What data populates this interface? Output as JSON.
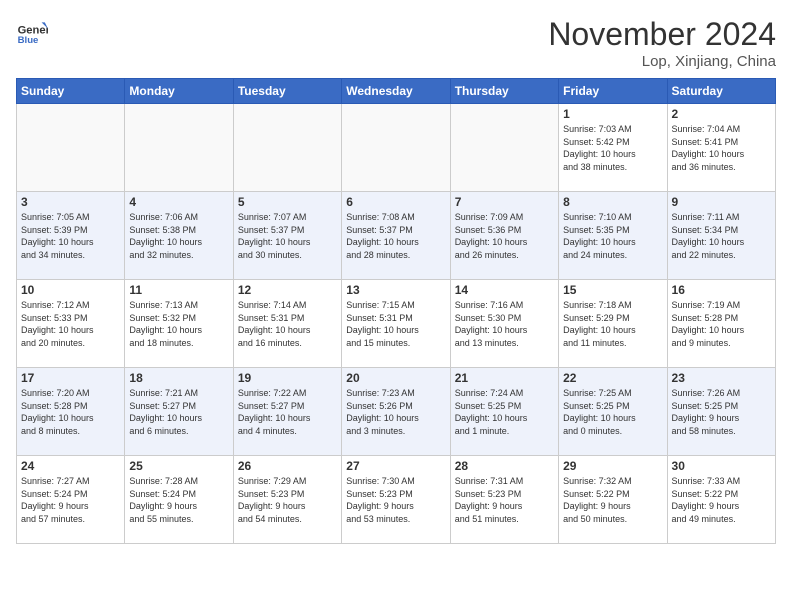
{
  "header": {
    "logo_line1": "General",
    "logo_line2": "Blue",
    "month": "November 2024",
    "location": "Lop, Xinjiang, China"
  },
  "weekdays": [
    "Sunday",
    "Monday",
    "Tuesday",
    "Wednesday",
    "Thursday",
    "Friday",
    "Saturday"
  ],
  "weeks": [
    [
      {
        "day": "",
        "info": ""
      },
      {
        "day": "",
        "info": ""
      },
      {
        "day": "",
        "info": ""
      },
      {
        "day": "",
        "info": ""
      },
      {
        "day": "",
        "info": ""
      },
      {
        "day": "1",
        "info": "Sunrise: 7:03 AM\nSunset: 5:42 PM\nDaylight: 10 hours\nand 38 minutes."
      },
      {
        "day": "2",
        "info": "Sunrise: 7:04 AM\nSunset: 5:41 PM\nDaylight: 10 hours\nand 36 minutes."
      }
    ],
    [
      {
        "day": "3",
        "info": "Sunrise: 7:05 AM\nSunset: 5:39 PM\nDaylight: 10 hours\nand 34 minutes."
      },
      {
        "day": "4",
        "info": "Sunrise: 7:06 AM\nSunset: 5:38 PM\nDaylight: 10 hours\nand 32 minutes."
      },
      {
        "day": "5",
        "info": "Sunrise: 7:07 AM\nSunset: 5:37 PM\nDaylight: 10 hours\nand 30 minutes."
      },
      {
        "day": "6",
        "info": "Sunrise: 7:08 AM\nSunset: 5:37 PM\nDaylight: 10 hours\nand 28 minutes."
      },
      {
        "day": "7",
        "info": "Sunrise: 7:09 AM\nSunset: 5:36 PM\nDaylight: 10 hours\nand 26 minutes."
      },
      {
        "day": "8",
        "info": "Sunrise: 7:10 AM\nSunset: 5:35 PM\nDaylight: 10 hours\nand 24 minutes."
      },
      {
        "day": "9",
        "info": "Sunrise: 7:11 AM\nSunset: 5:34 PM\nDaylight: 10 hours\nand 22 minutes."
      }
    ],
    [
      {
        "day": "10",
        "info": "Sunrise: 7:12 AM\nSunset: 5:33 PM\nDaylight: 10 hours\nand 20 minutes."
      },
      {
        "day": "11",
        "info": "Sunrise: 7:13 AM\nSunset: 5:32 PM\nDaylight: 10 hours\nand 18 minutes."
      },
      {
        "day": "12",
        "info": "Sunrise: 7:14 AM\nSunset: 5:31 PM\nDaylight: 10 hours\nand 16 minutes."
      },
      {
        "day": "13",
        "info": "Sunrise: 7:15 AM\nSunset: 5:31 PM\nDaylight: 10 hours\nand 15 minutes."
      },
      {
        "day": "14",
        "info": "Sunrise: 7:16 AM\nSunset: 5:30 PM\nDaylight: 10 hours\nand 13 minutes."
      },
      {
        "day": "15",
        "info": "Sunrise: 7:18 AM\nSunset: 5:29 PM\nDaylight: 10 hours\nand 11 minutes."
      },
      {
        "day": "16",
        "info": "Sunrise: 7:19 AM\nSunset: 5:28 PM\nDaylight: 10 hours\nand 9 minutes."
      }
    ],
    [
      {
        "day": "17",
        "info": "Sunrise: 7:20 AM\nSunset: 5:28 PM\nDaylight: 10 hours\nand 8 minutes."
      },
      {
        "day": "18",
        "info": "Sunrise: 7:21 AM\nSunset: 5:27 PM\nDaylight: 10 hours\nand 6 minutes."
      },
      {
        "day": "19",
        "info": "Sunrise: 7:22 AM\nSunset: 5:27 PM\nDaylight: 10 hours\nand 4 minutes."
      },
      {
        "day": "20",
        "info": "Sunrise: 7:23 AM\nSunset: 5:26 PM\nDaylight: 10 hours\nand 3 minutes."
      },
      {
        "day": "21",
        "info": "Sunrise: 7:24 AM\nSunset: 5:25 PM\nDaylight: 10 hours\nand 1 minute."
      },
      {
        "day": "22",
        "info": "Sunrise: 7:25 AM\nSunset: 5:25 PM\nDaylight: 10 hours\nand 0 minutes."
      },
      {
        "day": "23",
        "info": "Sunrise: 7:26 AM\nSunset: 5:25 PM\nDaylight: 9 hours\nand 58 minutes."
      }
    ],
    [
      {
        "day": "24",
        "info": "Sunrise: 7:27 AM\nSunset: 5:24 PM\nDaylight: 9 hours\nand 57 minutes."
      },
      {
        "day": "25",
        "info": "Sunrise: 7:28 AM\nSunset: 5:24 PM\nDaylight: 9 hours\nand 55 minutes."
      },
      {
        "day": "26",
        "info": "Sunrise: 7:29 AM\nSunset: 5:23 PM\nDaylight: 9 hours\nand 54 minutes."
      },
      {
        "day": "27",
        "info": "Sunrise: 7:30 AM\nSunset: 5:23 PM\nDaylight: 9 hours\nand 53 minutes."
      },
      {
        "day": "28",
        "info": "Sunrise: 7:31 AM\nSunset: 5:23 PM\nDaylight: 9 hours\nand 51 minutes."
      },
      {
        "day": "29",
        "info": "Sunrise: 7:32 AM\nSunset: 5:22 PM\nDaylight: 9 hours\nand 50 minutes."
      },
      {
        "day": "30",
        "info": "Sunrise: 7:33 AM\nSunset: 5:22 PM\nDaylight: 9 hours\nand 49 minutes."
      }
    ]
  ]
}
